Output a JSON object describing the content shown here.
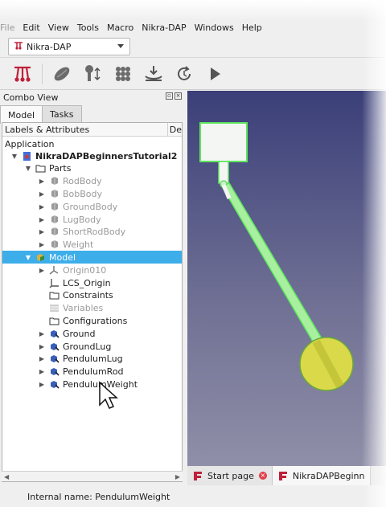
{
  "menu": [
    "File",
    "Edit",
    "View",
    "Tools",
    "Macro",
    "Nikra-DAP",
    "Windows",
    "Help"
  ],
  "workbench": {
    "selected": "Nikra-DAP"
  },
  "toolbar": {
    "icons": [
      "pendulum-icon",
      "body-icon",
      "joint-icon",
      "force-icon",
      "ground-icon",
      "reset-icon",
      "play-icon"
    ]
  },
  "combo": {
    "title": "Combo View",
    "tabs": [
      "Model",
      "Tasks"
    ]
  },
  "tree": {
    "header": {
      "col1": "Labels & Attributes",
      "col2": "De"
    },
    "root_label": "Application",
    "items": [
      {
        "label": "NikraDAPBeginnersTutorial2",
        "icon": "document-icon",
        "arrow": "▼"
      },
      {
        "label": "Parts",
        "icon": "folder-icon",
        "arrow": "▼"
      },
      {
        "label": "RodBody",
        "icon": "gear-icon",
        "arrow": "▶"
      },
      {
        "label": "BobBody",
        "icon": "gear-icon",
        "arrow": "▶"
      },
      {
        "label": "GroundBody",
        "icon": "gear-icon",
        "arrow": "▶"
      },
      {
        "label": "LugBody",
        "icon": "gear-icon",
        "arrow": "▶"
      },
      {
        "label": "ShortRodBody",
        "icon": "gear-icon",
        "arrow": "▶"
      },
      {
        "label": "Weight",
        "icon": "gear-icon",
        "arrow": "▶"
      },
      {
        "label": "Model",
        "icon": "assembly-icon",
        "arrow": "▼"
      },
      {
        "label": "Origin010",
        "icon": "origin-icon",
        "arrow": "▶"
      },
      {
        "label": "LCS_Origin",
        "icon": "lcs-icon",
        "arrow": ""
      },
      {
        "label": "Constraints",
        "icon": "folder-icon",
        "arrow": ""
      },
      {
        "label": "Variables",
        "icon": "table-icon",
        "arrow": ""
      },
      {
        "label": "Configurations",
        "icon": "folder-icon",
        "arrow": ""
      },
      {
        "label": "Ground",
        "icon": "link-icon",
        "arrow": "▶"
      },
      {
        "label": "GroundLug",
        "icon": "link-icon",
        "arrow": "▶"
      },
      {
        "label": "PendulumLug",
        "icon": "link-icon",
        "arrow": "▶"
      },
      {
        "label": "PendulumRod",
        "icon": "link-icon",
        "arrow": "▶"
      },
      {
        "label": "PendulumWeight",
        "icon": "link-icon",
        "arrow": "▶"
      }
    ]
  },
  "doc_tabs": [
    {
      "label": "Start page"
    },
    {
      "label": "NikraDAPBeginn"
    }
  ],
  "status": {
    "text": "Internal name: PendulumWeight"
  },
  "colors": {
    "selection": "#3daee9",
    "highlight": "#7cf07c",
    "weight": "#d9d94a"
  }
}
